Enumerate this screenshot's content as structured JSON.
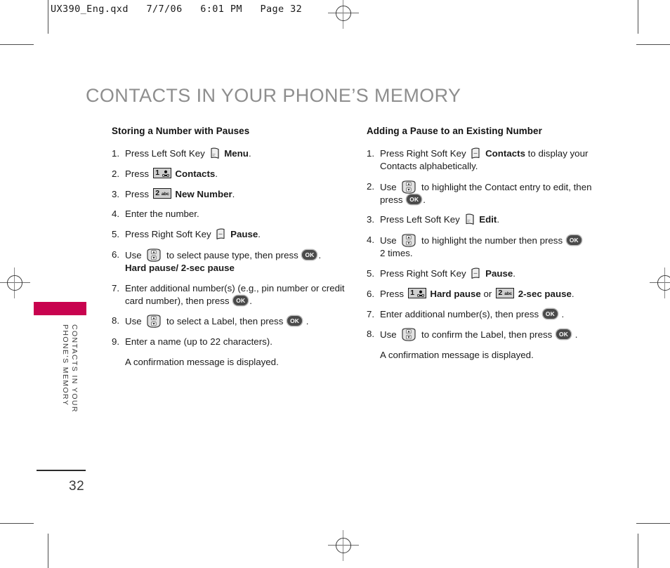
{
  "file_header": "UX390_Eng.qxd   7/7/06   6:01 PM   Page 32",
  "page_title": "CONTACTS IN YOUR PHONE’S MEMORY",
  "side_tab": {
    "text": "CONTACTS IN YOUR\nPHONE’S MEMORY",
    "bar_color": "#c8034f"
  },
  "page_number": "32",
  "colors": {
    "title_gray": "#8e8e8e",
    "accent_magenta": "#c8034f",
    "body_text": "#1b1b1b",
    "key_fill": "#cfcfcf",
    "ok_fill": "#4a4a4a"
  },
  "left_column": {
    "heading": "Storing a Number with Pauses",
    "steps": [
      {
        "num": "1.",
        "parts": [
          {
            "t": "text",
            "v": "Press Left Soft Key "
          },
          {
            "t": "icon",
            "v": "left-soft-key"
          },
          {
            "t": "bold",
            "v": " Menu"
          },
          {
            "t": "text",
            "v": "."
          }
        ]
      },
      {
        "num": "2.",
        "parts": [
          {
            "t": "text",
            "v": "Press "
          },
          {
            "t": "icon",
            "v": "key-1-voicemail"
          },
          {
            "t": "bold",
            "v": "  Contacts"
          },
          {
            "t": "text",
            "v": "."
          }
        ]
      },
      {
        "num": "3.",
        "parts": [
          {
            "t": "text",
            "v": "Press "
          },
          {
            "t": "icon",
            "v": "key-2-abc"
          },
          {
            "t": "bold",
            "v": "  New Number"
          },
          {
            "t": "text",
            "v": "."
          }
        ]
      },
      {
        "num": "4.",
        "parts": [
          {
            "t": "text",
            "v": "Enter the number."
          }
        ]
      },
      {
        "num": "5.",
        "parts": [
          {
            "t": "text",
            "v": "Press Right Soft Key "
          },
          {
            "t": "icon",
            "v": "right-soft-key"
          },
          {
            "t": "bold",
            "v": " Pause"
          },
          {
            "t": "text",
            "v": "."
          }
        ]
      },
      {
        "num": "6.",
        "parts": [
          {
            "t": "text",
            "v": "Use "
          },
          {
            "t": "icon",
            "v": "navigation-key"
          },
          {
            "t": "text",
            "v": " to select pause type, then press "
          },
          {
            "t": "icon",
            "v": "ok-key"
          },
          {
            "t": "text",
            "v": "."
          },
          {
            "t": "br",
            "v": ""
          },
          {
            "t": "bold",
            "v": "Hard pause/ 2-sec pause"
          }
        ]
      },
      {
        "num": "7.",
        "parts": [
          {
            "t": "text",
            "v": "Enter additional number(s) (e.g., pin number or credit card number), then press "
          },
          {
            "t": "icon",
            "v": "ok-key"
          },
          {
            "t": "text",
            "v": "."
          }
        ]
      },
      {
        "num": "8.",
        "parts": [
          {
            "t": "text",
            "v": "Use "
          },
          {
            "t": "icon",
            "v": "navigation-key"
          },
          {
            "t": "text",
            "v": " to select a Label, then press "
          },
          {
            "t": "icon",
            "v": "ok-key"
          },
          {
            "t": "text",
            "v": " ."
          }
        ]
      },
      {
        "num": "9.",
        "parts": [
          {
            "t": "text",
            "v": "Enter a name (up to 22 characters)."
          }
        ]
      }
    ],
    "note": "A confirmation message is displayed."
  },
  "right_column": {
    "heading": "Adding a Pause to an Existing Number",
    "steps": [
      {
        "num": "1.",
        "parts": [
          {
            "t": "text",
            "v": "Press Right Soft Key "
          },
          {
            "t": "icon",
            "v": "right-soft-key"
          },
          {
            "t": "bold",
            "v": " Contacts"
          },
          {
            "t": "text",
            "v": " to display your Contacts alphabetically."
          }
        ]
      },
      {
        "num": "2.",
        "parts": [
          {
            "t": "text",
            "v": "Use "
          },
          {
            "t": "icon",
            "v": "navigation-key"
          },
          {
            "t": "text",
            "v": " to highlight the Contact entry to edit, then press "
          },
          {
            "t": "icon",
            "v": "ok-key"
          },
          {
            "t": "text",
            "v": "."
          }
        ]
      },
      {
        "num": "3.",
        "parts": [
          {
            "t": "text",
            "v": "Press Left Soft Key "
          },
          {
            "t": "icon",
            "v": "left-soft-key"
          },
          {
            "t": "bold",
            "v": " Edit"
          },
          {
            "t": "text",
            "v": "."
          }
        ]
      },
      {
        "num": "4.",
        "parts": [
          {
            "t": "text",
            "v": "Use "
          },
          {
            "t": "icon",
            "v": "navigation-key"
          },
          {
            "t": "text",
            "v": " to highlight the number then press "
          },
          {
            "t": "icon",
            "v": "ok-key"
          },
          {
            "t": "br",
            "v": ""
          },
          {
            "t": "text",
            "v": "2 times."
          }
        ]
      },
      {
        "num": "5.",
        "parts": [
          {
            "t": "text",
            "v": "Press Right Soft Key "
          },
          {
            "t": "icon",
            "v": "right-soft-key"
          },
          {
            "t": "bold",
            "v": " Pause"
          },
          {
            "t": "text",
            "v": "."
          }
        ]
      },
      {
        "num": "6.",
        "parts": [
          {
            "t": "text",
            "v": "Press "
          },
          {
            "t": "icon",
            "v": "key-1-voicemail"
          },
          {
            "t": "bold",
            "v": " Hard pause"
          },
          {
            "t": "text",
            "v": " or "
          },
          {
            "t": "icon",
            "v": "key-2-abc"
          },
          {
            "t": "bold",
            "v": "  2-sec pause"
          },
          {
            "t": "text",
            "v": "."
          }
        ]
      },
      {
        "num": "7.",
        "parts": [
          {
            "t": "text",
            "v": "Enter additional number(s), then press "
          },
          {
            "t": "icon",
            "v": "ok-key"
          },
          {
            "t": "text",
            "v": " ."
          }
        ]
      },
      {
        "num": "8.",
        "parts": [
          {
            "t": "text",
            "v": "Use "
          },
          {
            "t": "icon",
            "v": "navigation-key"
          },
          {
            "t": "text",
            "v": " to confirm the Label, then press "
          },
          {
            "t": "icon",
            "v": "ok-key"
          },
          {
            "t": "text",
            "v": " ."
          }
        ]
      }
    ],
    "note": "A confirmation message is displayed."
  },
  "icon_labels": {
    "key_1_number": "1",
    "key_2_number": "2",
    "key_2_letters": "abc",
    "ok_label": "OK"
  }
}
